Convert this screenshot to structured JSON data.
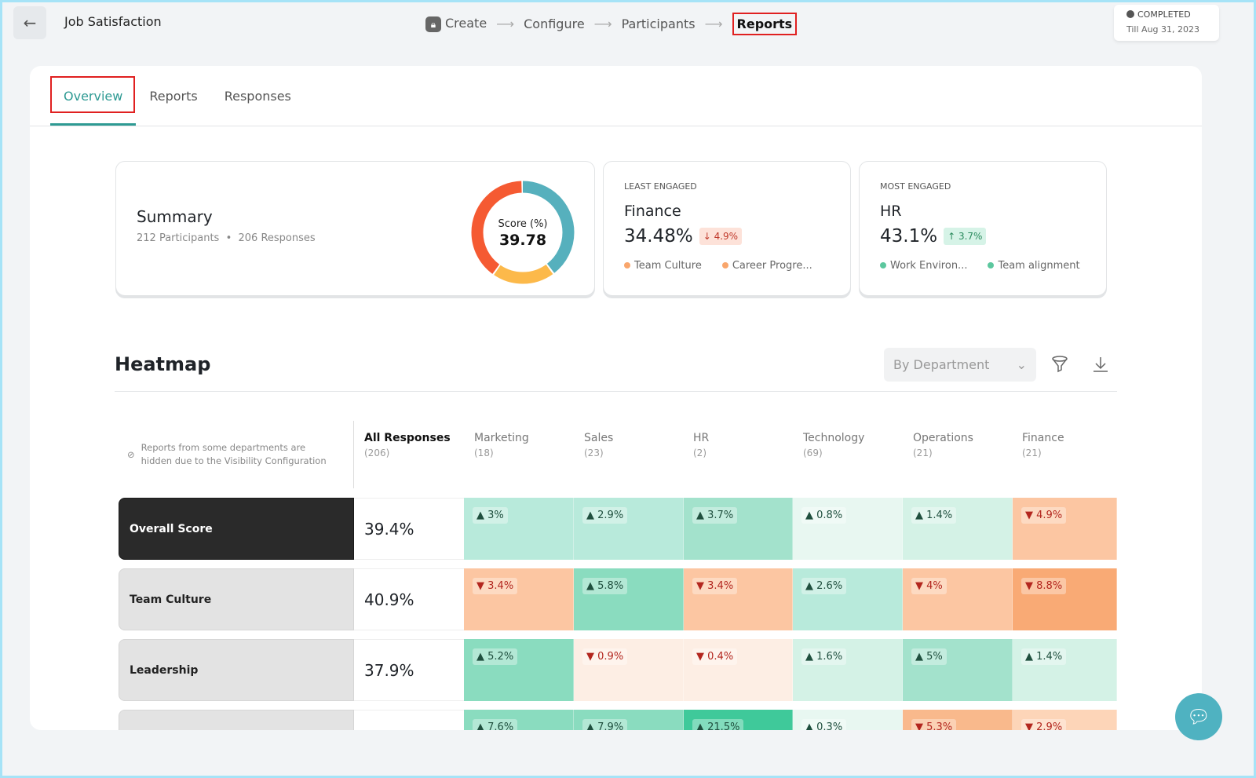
{
  "header": {
    "title": "Job Satisfaction",
    "steps": [
      "Create",
      "Configure",
      "Participants",
      "Reports"
    ],
    "active_step": "Reports",
    "status": "COMPLETED",
    "till": "Till Aug 31, 2023"
  },
  "tabs": [
    "Overview",
    "Reports",
    "Responses"
  ],
  "summary": {
    "title": "Summary",
    "participants": "212 Participants",
    "responses": "206 Responses",
    "score_label": "Score (%)",
    "score": "39.78",
    "donut": [
      {
        "color": "#56b0bd",
        "share": 0.4
      },
      {
        "color": "#fcb94a",
        "share": 0.2
      },
      {
        "color": "#f55a32",
        "share": 0.4
      }
    ]
  },
  "least": {
    "caption": "LEAST ENGAGED",
    "name": "Finance",
    "value": "34.48%",
    "delta": "↓ 4.9%",
    "tags": [
      "Team Culture",
      "Career Progre..."
    ],
    "tag_color": "#f9a66c"
  },
  "most": {
    "caption": "MOST ENGAGED",
    "name": "HR",
    "value": "43.1%",
    "delta": "↑ 3.7%",
    "tags": [
      "Work Environ...",
      "Team alignment"
    ],
    "tag_color": "#5cc79e"
  },
  "heatmap": {
    "title": "Heatmap",
    "group_by": "By Department",
    "note": "Reports from some departments are hidden due to the Visibility Configuration",
    "columns": [
      {
        "name": "All Responses",
        "n": "(206)"
      },
      {
        "name": "Marketing",
        "n": "(18)"
      },
      {
        "name": "Sales",
        "n": "(23)"
      },
      {
        "name": "HR",
        "n": "(2)"
      },
      {
        "name": "Technology",
        "n": "(69)"
      },
      {
        "name": "Operations",
        "n": "(21)"
      },
      {
        "name": "Finance",
        "n": "(21)"
      }
    ],
    "rows": [
      {
        "label": "Overall Score",
        "all": "39.4%",
        "cells": [
          [
            "up",
            "3%",
            "#b8eadb"
          ],
          [
            "up",
            "2.9%",
            "#b8eadb"
          ],
          [
            "up",
            "3.7%",
            "#a3e2cc"
          ],
          [
            "up",
            "0.8%",
            "#e8f7f1"
          ],
          [
            "up",
            "1.4%",
            "#d4f2e6"
          ],
          [
            "down",
            "4.9%",
            "#fcc6a2"
          ]
        ]
      },
      {
        "label": "Team Culture",
        "all": "40.9%",
        "cells": [
          [
            "down",
            "3.4%",
            "#fcc6a2"
          ],
          [
            "up",
            "5.8%",
            "#8adcbf"
          ],
          [
            "down",
            "3.4%",
            "#fcc6a2"
          ],
          [
            "up",
            "2.6%",
            "#b8eadb"
          ],
          [
            "down",
            "4%",
            "#fcc6a2"
          ],
          [
            "down",
            "8.8%",
            "#f9aa75"
          ]
        ]
      },
      {
        "label": "Leadership",
        "all": "37.9%",
        "cells": [
          [
            "up",
            "5.2%",
            "#8adcbf"
          ],
          [
            "down",
            "0.9%",
            "#fdeee4"
          ],
          [
            "down",
            "0.4%",
            "#fdeee4"
          ],
          [
            "up",
            "1.6%",
            "#d4f2e6"
          ],
          [
            "up",
            "5%",
            "#a3e2cc"
          ],
          [
            "up",
            "1.4%",
            "#d4f2e6"
          ]
        ]
      },
      {
        "label": "",
        "all": "",
        "cells": [
          [
            "up",
            "7.6%",
            "#8adcbf"
          ],
          [
            "up",
            "7.9%",
            "#8adcbf"
          ],
          [
            "up",
            "21.5%",
            "#3fc99a"
          ],
          [
            "up",
            "0.3%",
            "#e8f7f1"
          ],
          [
            "down",
            "5.3%",
            "#f9b98c"
          ],
          [
            "down",
            "2.9%",
            "#fdd5b8"
          ]
        ]
      }
    ]
  }
}
